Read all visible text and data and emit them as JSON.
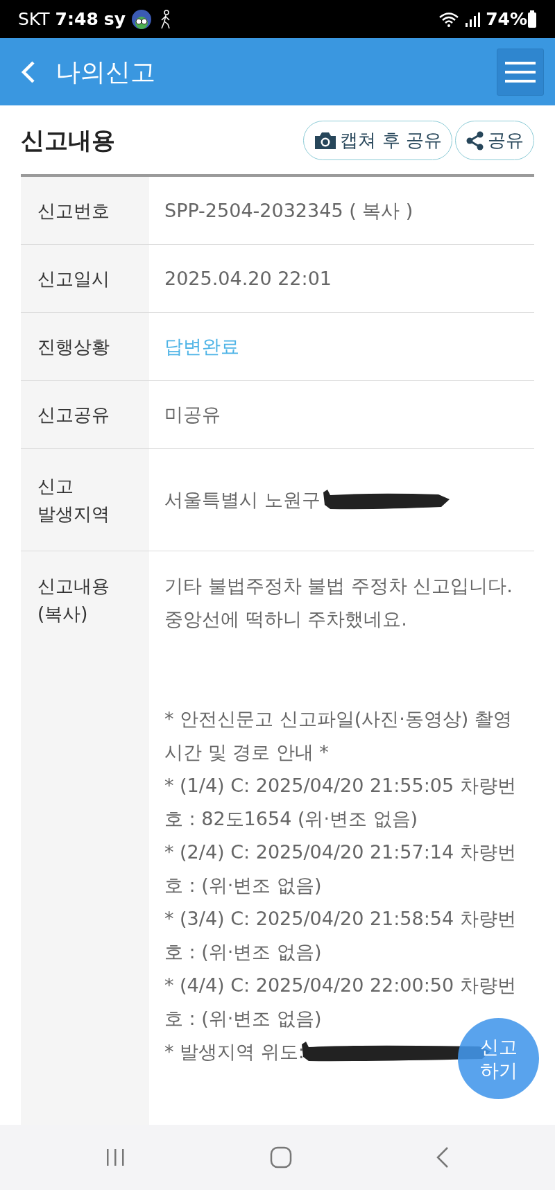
{
  "status_bar": {
    "carrier": "SKT",
    "time": "7:48",
    "tag": "sy",
    "battery": "74%"
  },
  "header": {
    "title": "나의신고"
  },
  "section": {
    "title": "신고내용",
    "buttons": [
      {
        "kind": "camera",
        "label": "캡쳐 후 공유"
      },
      {
        "kind": "share",
        "label": "공유"
      }
    ]
  },
  "rows": [
    {
      "label": [
        "신고번호"
      ],
      "value": "SPP-2504-2032345 ( 복사 )",
      "kind": "plain"
    },
    {
      "label": [
        "신고일시"
      ],
      "value": "2025.04.20 22:01",
      "kind": "plain"
    },
    {
      "label": [
        "진행상황"
      ],
      "value": "답변완료",
      "kind": "status"
    },
    {
      "label": [
        "신고공유"
      ],
      "value": "미공유",
      "kind": "plain"
    },
    {
      "label": [
        "신고",
        "발생지역"
      ],
      "value": "서울특별시 노원구",
      "kind": "redacted"
    }
  ],
  "content_row": {
    "label": [
      "신고내용",
      "(복사)"
    ],
    "blocks": [
      [
        "기타 불법주정차 불법 주정차 신고입니다.",
        "중앙선에 떡하니 주차했네요."
      ],
      [
        "* 안전신문고 신고파일(사진·동영상) 촬영시간 및 경로 안내 *",
        "* (1/4) C: 2025/04/20 21:55:05 차량번호 : 82도1654 (위·변조 없음)",
        "* (2/4) C: 2025/04/20 21:57:14 차량번호 : (위·변조 없음)",
        "* (3/4) C: 2025/04/20 21:58:54 차량번호 : (위·변조 없음)",
        "* (4/4) C: 2025/04/20 22:00:50 차량번호 : (위·변조 없음)"
      ]
    ],
    "last_line": "* 발생지역 위도:"
  },
  "fab": [
    "신고",
    "하기"
  ]
}
